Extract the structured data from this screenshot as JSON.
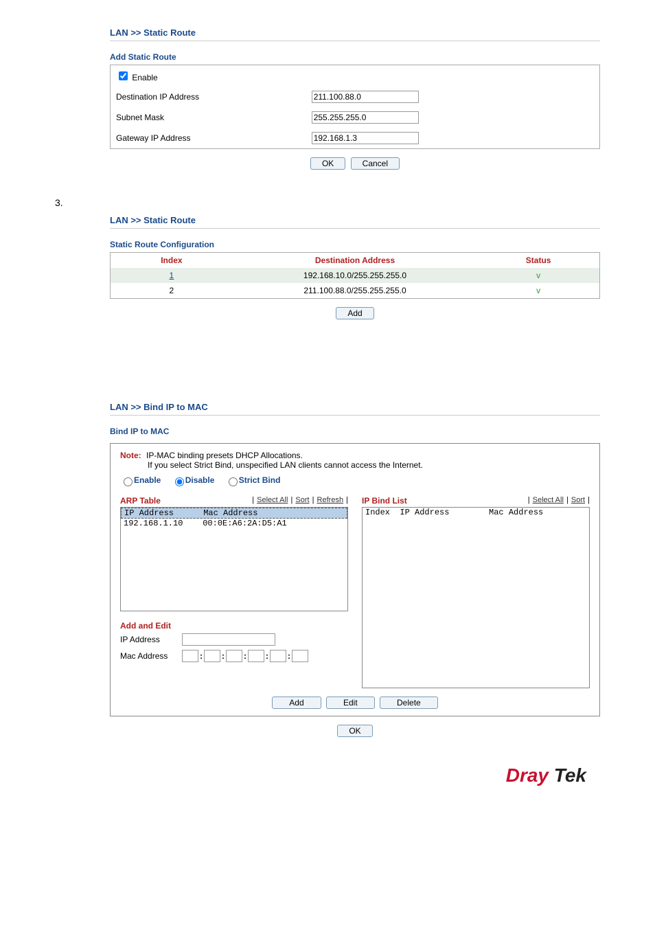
{
  "section1": {
    "breadcrumb": "LAN >> Static Route",
    "subhead": "Add Static Route",
    "enable_label": "Enable",
    "enable_checked": true,
    "fields": {
      "dest_label": "Destination IP Address",
      "dest_value": "211.100.88.0",
      "mask_label": "Subnet Mask",
      "mask_value": "255.255.255.0",
      "gw_label": "Gateway IP Address",
      "gw_value": "192.168.1.3"
    },
    "ok": "OK",
    "cancel": "Cancel"
  },
  "step_num": "3.",
  "section2": {
    "breadcrumb": "LAN >> Static Route",
    "subhead": "Static Route Configuration",
    "headers": {
      "index": "Index",
      "dest": "Destination Address",
      "status": "Status"
    },
    "rows": [
      {
        "index": "1",
        "dest": "192.168.10.0/255.255.255.0",
        "status": "v"
      },
      {
        "index": "2",
        "dest": "211.100.88.0/255.255.255.0",
        "status": "v"
      }
    ],
    "add": "Add"
  },
  "section3": {
    "breadcrumb": "LAN >> Bind IP to MAC",
    "subhead": "Bind IP to MAC",
    "note_label": "Note:",
    "note_line1": "IP-MAC binding presets DHCP Allocations.",
    "note_line2": "If you select Strict Bind, unspecified LAN clients cannot access the Internet.",
    "radio": {
      "enable": "Enable",
      "disable": "Disable",
      "strict": "Strict Bind",
      "selected": "disable"
    },
    "arp": {
      "title": "ARP Table",
      "links": {
        "select_all": "Select All",
        "sort": "Sort",
        "refresh": "Refresh"
      },
      "header": "IP Address      Mac Address",
      "rows": [
        "192.168.1.10    00:0E:A6:2A:D5:A1"
      ]
    },
    "bind": {
      "title": "IP Bind List",
      "links": {
        "select_all": "Select All",
        "sort": "Sort"
      },
      "header": "Index  IP Address        Mac Address"
    },
    "add_edit": {
      "title": "Add and Edit",
      "ip_label": "IP Address",
      "mac_label": "Mac Address"
    },
    "buttons": {
      "add": "Add",
      "edit": "Edit",
      "delete": "Delete",
      "ok": "OK"
    }
  },
  "logo": {
    "part1": "Dray",
    "part2": " Tek"
  }
}
